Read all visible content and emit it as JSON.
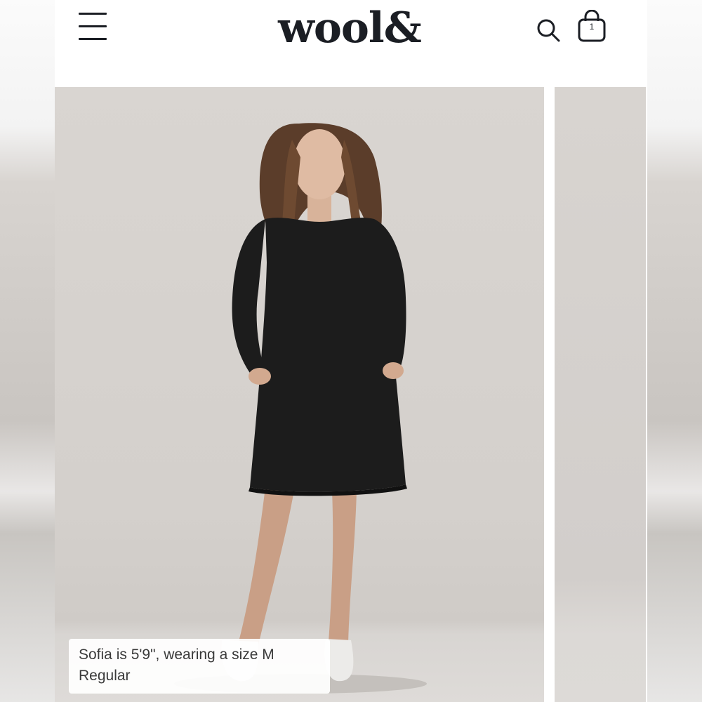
{
  "header": {
    "logo_text": "wool&",
    "menu_icon": "hamburger-menu-icon",
    "search_icon": "search-icon",
    "cart_icon": "shopping-bag-icon",
    "cart_count": "1"
  },
  "gallery": {
    "main_image_caption": "Sofia is 5'9\", wearing a size M Regular",
    "caption_line1": "Sofia is 5'9\", wearing a size M",
    "caption_line2": "Regular",
    "dress_color": "#1c1c1c"
  },
  "colors": {
    "text_primary": "#1b1e24",
    "background": "#ffffff",
    "photo_backdrop": "#d6d2ce"
  }
}
